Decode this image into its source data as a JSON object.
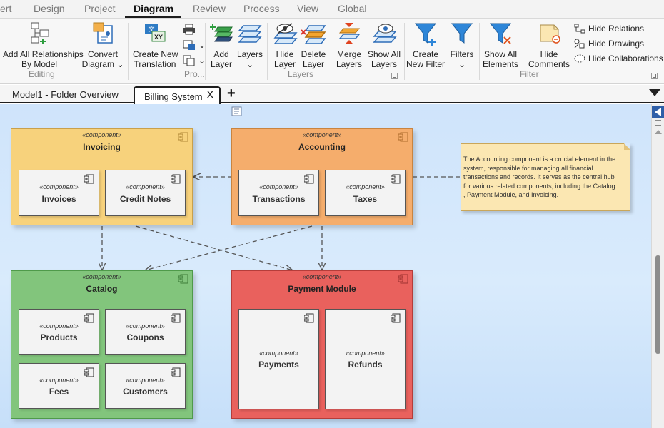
{
  "ribbon_tabs": [
    {
      "label": "ert",
      "active": false
    },
    {
      "label": "Design",
      "active": false
    },
    {
      "label": "Project",
      "active": false
    },
    {
      "label": "Diagram",
      "active": true
    },
    {
      "label": "Review",
      "active": false
    },
    {
      "label": "Process",
      "active": false
    },
    {
      "label": "View",
      "active": false
    },
    {
      "label": "Global",
      "active": false
    }
  ],
  "ribbon": {
    "add_all_relationships": [
      "Add All Relationships",
      "By Model"
    ],
    "convert_diagram": [
      "Convert",
      "Diagram"
    ],
    "create_new_translation": [
      "Create New",
      "Translation"
    ],
    "add_layer": [
      "Add",
      "Layer"
    ],
    "layers": [
      "Layers",
      "⌄"
    ],
    "hide_layer": [
      "Hide",
      "Layer"
    ],
    "delete_layer": [
      "Delete",
      "Layer"
    ],
    "merge_layers": [
      "Merge",
      "Layers"
    ],
    "show_all_layers": [
      "Show All",
      "Layers"
    ],
    "create_new_filter": [
      "Create",
      "New Filter"
    ],
    "filters": [
      "Filters",
      "⌄"
    ],
    "show_all_elements": [
      "Show All",
      "Elements"
    ],
    "hide_comments": [
      "Hide",
      "Comments"
    ],
    "hide_relations": "Hide Relations",
    "hide_drawings": "Hide Drawings",
    "hide_collaborations": "Hide Collaborations",
    "groups": {
      "editing": "Editing",
      "pro": "Pro...",
      "layers": "Layers",
      "filter": "Filter"
    }
  },
  "doc_tabs": {
    "model_tab": "Model1 - Folder Overview",
    "active_tab": "Billing System",
    "close_glyph": "X",
    "add_glyph": "+"
  },
  "diagram": {
    "stereotype": "«component»",
    "components": {
      "invoicing": {
        "name": "Invoicing",
        "children": [
          "Invoices",
          "Credit Notes"
        ],
        "fill": "#f7d27c"
      },
      "accounting": {
        "name": "Accounting",
        "children": [
          "Transactions",
          "Taxes"
        ],
        "fill": "#f5ad6c"
      },
      "catalog": {
        "name": "Catalog",
        "children": [
          "Products",
          "Coupons",
          "Fees",
          "Customers"
        ],
        "fill": "#82c57c"
      },
      "payment": {
        "name": "Payment Module",
        "children": [
          "Payments",
          "Refunds"
        ],
        "fill": "#e9615d"
      }
    },
    "note_lines": [
      "The Accounting component is a crucial element in the",
      "system, responsible for managing all financial",
      "transactions and records. It serves as the central hub",
      "for various related components, including the Catalog",
      ", Payment Module, and Invoicing."
    ]
  },
  "colors": {
    "canvas": "#d4e8fb",
    "invoicing": "#f7d27c",
    "accounting": "#f5ad6c",
    "catalog": "#82c57c",
    "payment": "#e9615d",
    "note": "#fbe7b2",
    "scroll_button": "#2f5fa8"
  }
}
